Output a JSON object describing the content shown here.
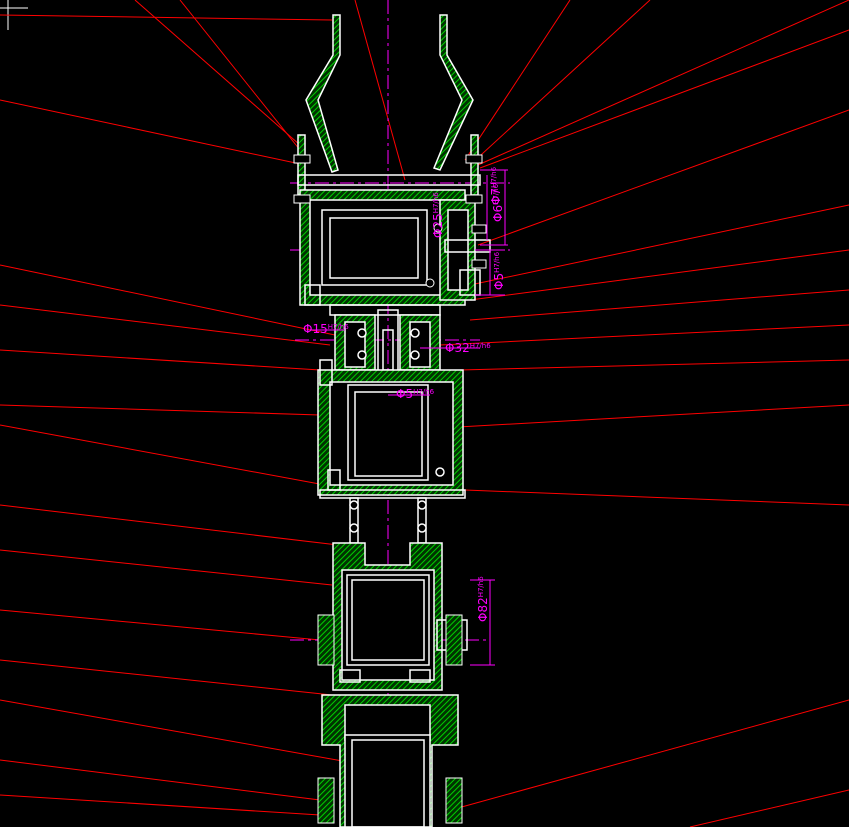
{
  "colors": {
    "background": "#000000",
    "outline": "#ffffff",
    "hatch": "#00c000",
    "leader": "#ff0000",
    "centerline": "#ff00ff",
    "dimension": "#ff00ff"
  },
  "dimensions": {
    "d1": {
      "text": "Φ7",
      "tol": "H7/h6"
    },
    "d2": {
      "text": "Φ6",
      "tol": "H7/h6"
    },
    "d3": {
      "text": "Φ25",
      "tol": "H7/h6"
    },
    "d4": {
      "text": "Φ5",
      "tol": "H7/h6"
    },
    "d5": {
      "text": "Φ15",
      "tol": "H7/h6"
    },
    "d6": {
      "text": "Φ32",
      "tol": "H7/h6"
    },
    "d7": {
      "text": "Φ5",
      "tol": "H7/h6"
    },
    "d8": {
      "text": "Φ82",
      "tol": "H7/h6"
    }
  }
}
